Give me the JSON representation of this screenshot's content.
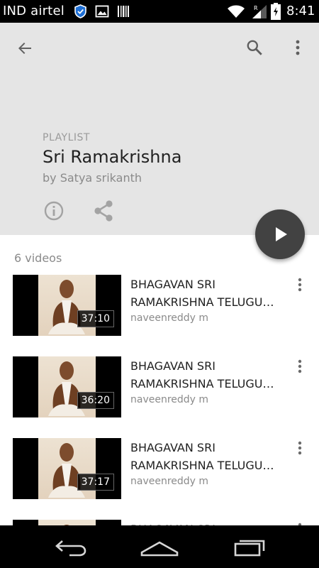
{
  "status_bar": {
    "carrier": "IND airtel",
    "time": "8:41",
    "icons": [
      "shield-icon",
      "gallery-icon",
      "barcode-icon",
      "wifi-icon",
      "signal-icon",
      "battery-icon"
    ],
    "signal_badge": "R"
  },
  "header": {
    "back_icon": "arrow-back-icon",
    "search_icon": "search-icon",
    "more_icon": "more-vert-icon",
    "playlist_label": "PLAYLIST",
    "title": "Sri Ramakrishna",
    "owner": "by Satya srikanth",
    "info_icon": "info-icon",
    "share_icon": "share-icon",
    "background": "#e5e5e5"
  },
  "play_fab": {
    "icon": "play-icon",
    "color": "#424242"
  },
  "video_count": "6 videos",
  "videos": [
    {
      "title_line1": "BHAGAVAN SRI",
      "title_line2": "RAMAKRISHNA TELUGU…",
      "channel": "naveenreddy m",
      "duration": "37:10"
    },
    {
      "title_line1": "BHAGAVAN SRI",
      "title_line2": "RAMAKRISHNA TELUGU…",
      "channel": "naveenreddy m",
      "duration": "36:20"
    },
    {
      "title_line1": "BHAGAVAN SRI",
      "title_line2": "RAMAKRISHNA TELUGU…",
      "channel": "naveenreddy m",
      "duration": "37:17"
    },
    {
      "title_line1": "BHAGAVAN SRI",
      "title_line2": "",
      "channel": "",
      "duration": ""
    }
  ],
  "nav_bar": {
    "back_icon": "nav-back-icon",
    "home_icon": "nav-home-icon",
    "recents_icon": "nav-recents-icon"
  }
}
